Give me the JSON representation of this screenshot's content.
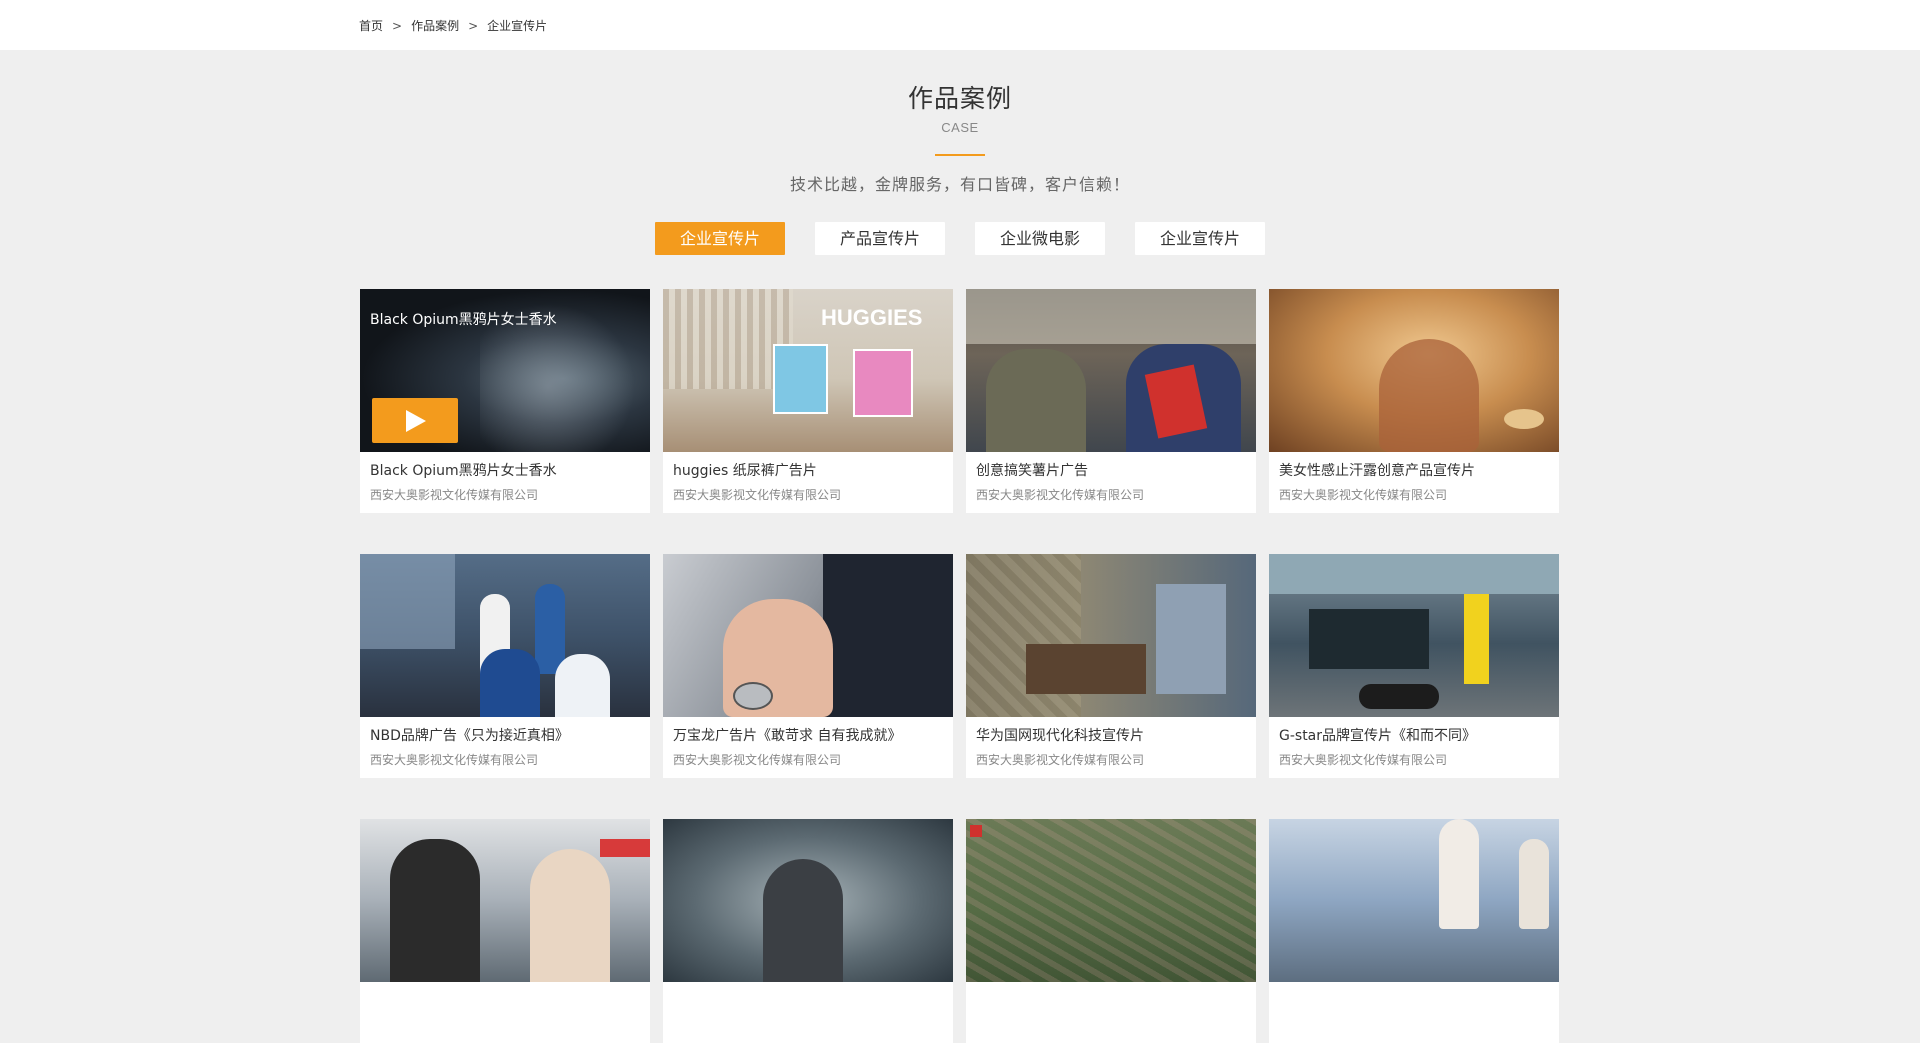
{
  "breadcrumb": {
    "items": [
      "首页",
      "作品案例",
      "企业宣传片"
    ],
    "separator": ">"
  },
  "heading": {
    "title": "作品案例",
    "subtitle": "CASE",
    "slogan": "技术比越，金牌服务，有口皆碑，客户信赖！"
  },
  "tabs": [
    {
      "label": "企业宣传片",
      "active": true
    },
    {
      "label": "产品宣传片",
      "active": false
    },
    {
      "label": "企业微电影",
      "active": false
    },
    {
      "label": "企业宣传片",
      "active": false
    }
  ],
  "accent_color": "#f39b1d",
  "cases": [
    {
      "title": "Black Opium黑鸦片女士香水",
      "company": "西安大奥影视文化传媒有限公司",
      "overlay_title": "Black Opium黑鸦片女士香水",
      "play_icon": "play-icon"
    },
    {
      "title": "huggies 纸尿裤广告片",
      "company": "西安大奥影视文化传媒有限公司",
      "thumb_text": "HUGGIES"
    },
    {
      "title": "创意搞笑薯片广告",
      "company": "西安大奥影视文化传媒有限公司"
    },
    {
      "title": "美女性感止汗露创意产品宣传片",
      "company": "西安大奥影视文化传媒有限公司"
    },
    {
      "title": "NBD品牌广告《只为接近真相》",
      "company": "西安大奥影视文化传媒有限公司"
    },
    {
      "title": "万宝龙广告片《敢苛求 自有我成就》",
      "company": "西安大奥影视文化传媒有限公司"
    },
    {
      "title": "华为国网现代化科技宣传片",
      "company": "西安大奥影视文化传媒有限公司"
    },
    {
      "title": "G-star品牌宣传片《和而不同》",
      "company": "西安大奥影视文化传媒有限公司"
    },
    {
      "title": "",
      "company": ""
    },
    {
      "title": "",
      "company": ""
    },
    {
      "title": "",
      "company": ""
    },
    {
      "title": "",
      "company": ""
    }
  ]
}
